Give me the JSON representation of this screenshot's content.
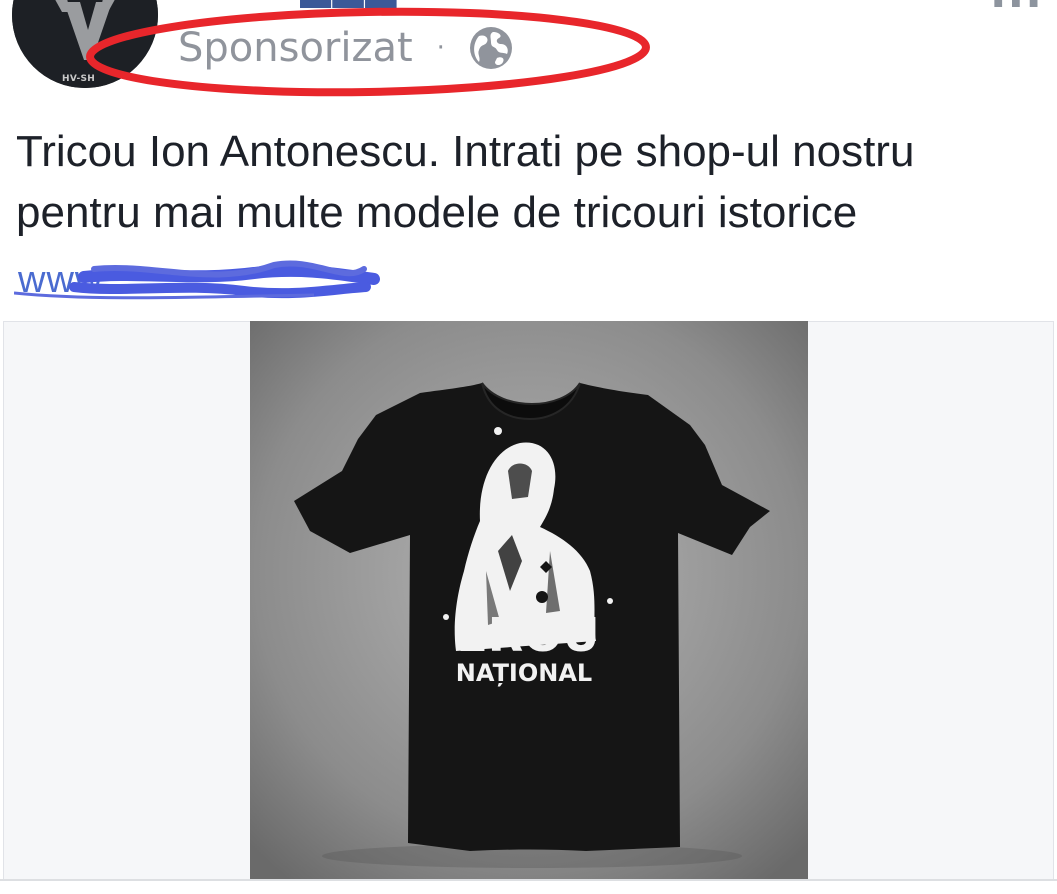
{
  "post": {
    "sponsored_label": "Sponsorizat",
    "separator": "·",
    "audience_icon": "globe-icon",
    "more_icon": "more-options-icon",
    "caption": "Tricou Ion Antonescu. Intrati pe shop-ul nostru pentru mai multe modele de tricouri istorice",
    "link_text": "www.",
    "avatar_text": "HV-SH"
  },
  "product_image": {
    "print_line1": "EROU",
    "print_line2": "NAȚIONAL"
  },
  "colors": {
    "link": "#4a6bd0",
    "annotation": "#e8262b",
    "meta": "#90949c"
  }
}
